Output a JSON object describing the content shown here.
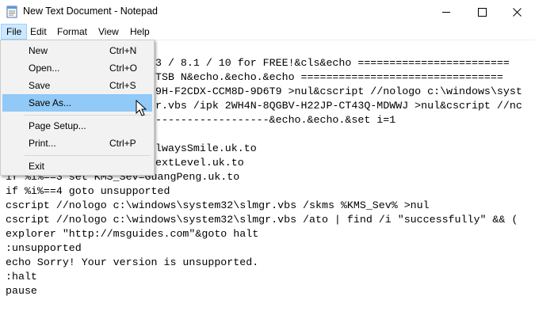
{
  "window": {
    "title": "New Text Document - Notepad",
    "minimize": "—",
    "maximize": "☐",
    "close": "✕"
  },
  "menubar": {
    "items": [
      "File",
      "Edit",
      "Format",
      "View",
      "Help"
    ],
    "active": "File"
  },
  "file_menu": {
    "items": [
      {
        "label": "New",
        "shortcut": "Ctrl+N"
      },
      {
        "label": "Open...",
        "shortcut": "Ctrl+O"
      },
      {
        "label": "Save",
        "shortcut": "Ctrl+S"
      },
      {
        "label": "Save As...",
        "shortcut": ""
      },
      {
        "label": "Page Setup...",
        "shortcut": ""
      },
      {
        "label": "Print...",
        "shortcut": "Ctrl+P"
      },
      {
        "label": "Exit",
        "shortcut": ""
      }
    ],
    "highlighted": "Save As..."
  },
  "editor": {
    "lines": [
      "3 / 8.1 / 10 for FREE!&cls&echo ========================",
      "TSB N&echo.&echo.&echo ================================",
      "9H-F2CDX-CCM8D-9D6T9 >nul&cscript //nologo c:\\windows\\syst",
      "r.vbs /ipk 2WH4N-8QGBV-H22JP-CT43Q-MDWWJ >nul&cscript //nc",
      "------------------&echo.&echo.&set i=1",
      "",
      "lwaysSmile.uk.to",
      "extLevel.uk.to",
      "if %i%==3 set KMS_Sev=GuangPeng.uk.to",
      "if %i%==4 goto unsupported",
      "cscript //nologo c:\\windows\\system32\\slmgr.vbs /skms %KMS_Sev% >nul",
      "cscript //nologo c:\\windows\\system32\\slmgr.vbs /ato | find /i \"successfully\" && (",
      "explorer \"http://msguides.com\"&goto halt",
      ":unsupported",
      "echo Sorry! Your version is unsupported.",
      ":halt",
      "pause"
    ]
  },
  "colors": {
    "menu_hover": "#91c9f7",
    "menubar_active": "#cce8ff",
    "menu_background": "#f2f2f2"
  },
  "icons": {
    "app": "notepad-icon",
    "cursor": "mouse-pointer-icon"
  }
}
